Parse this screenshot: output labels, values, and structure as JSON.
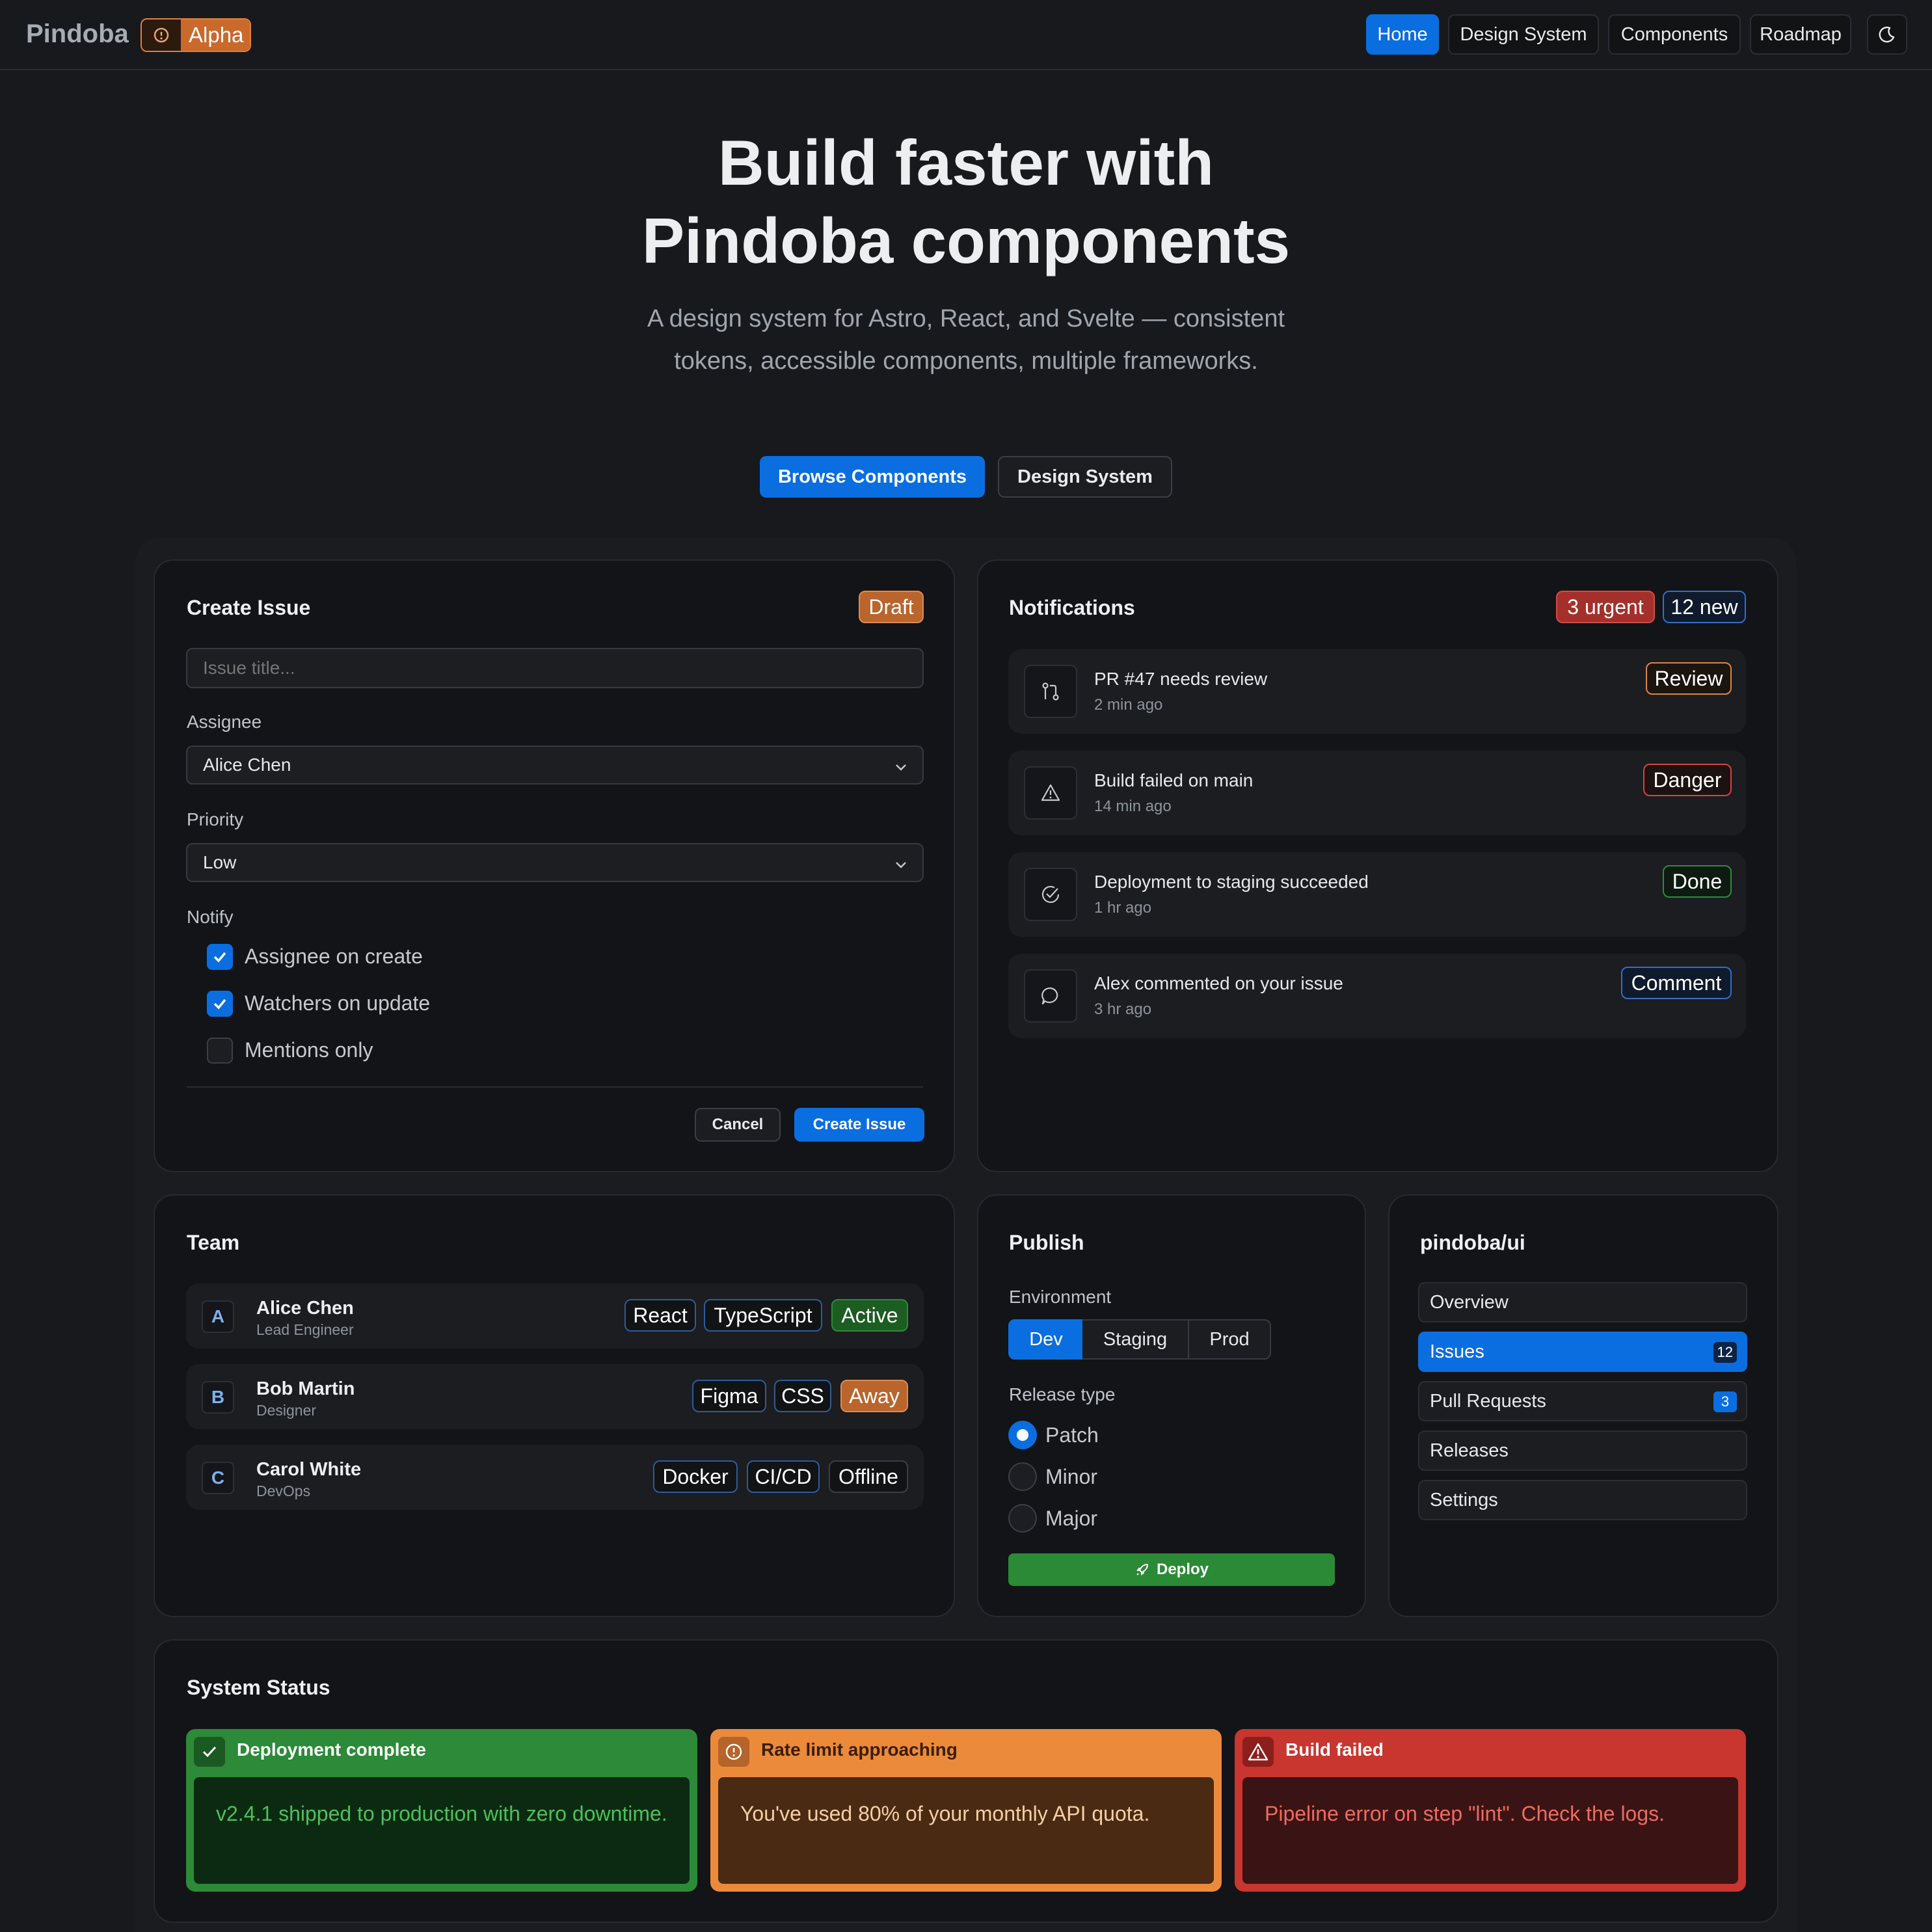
{
  "nav": {
    "brand": "Pindoba",
    "badge": "Alpha",
    "links": [
      "Home",
      "Design System",
      "Components",
      "Roadmap"
    ]
  },
  "hero": {
    "title_line1": "Build faster with",
    "title_line2": "Pindoba components",
    "subtitle": "A design system for Astro, React, and Svelte — consistent tokens, accessible components, multiple frameworks.",
    "primary_cta": "Browse Components",
    "secondary_cta": "Design System"
  },
  "create_issue": {
    "title": "Create Issue",
    "status": "Draft",
    "title_placeholder": "Issue title...",
    "assignee_label": "Assignee",
    "assignee_value": "Alice Chen",
    "priority_label": "Priority",
    "priority_value": "Low",
    "notify_label": "Notify",
    "options": [
      {
        "label": "Assignee on create",
        "checked": true
      },
      {
        "label": "Watchers on update",
        "checked": true
      },
      {
        "label": "Mentions only",
        "checked": false
      }
    ],
    "cancel": "Cancel",
    "submit": "Create Issue"
  },
  "notifications": {
    "title": "Notifications",
    "urgent": "3 urgent",
    "new": "12 new",
    "items": [
      {
        "icon": "pull-request-icon",
        "title": "PR #47 needs review",
        "time": "2 min ago",
        "tag": "Review"
      },
      {
        "icon": "warning-icon",
        "title": "Build failed on main",
        "time": "14 min ago",
        "tag": "Danger"
      },
      {
        "icon": "check-circle-icon",
        "title": "Deployment to staging succeeded",
        "time": "1 hr ago",
        "tag": "Done"
      },
      {
        "icon": "comment-icon",
        "title": "Alex commented on your issue",
        "time": "3 hr ago",
        "tag": "Comment"
      }
    ]
  },
  "team": {
    "title": "Team",
    "members": [
      {
        "initial": "A",
        "name": "Alice Chen",
        "role": "Lead Engineer",
        "tags": [
          "React",
          "TypeScript"
        ],
        "status": "Active"
      },
      {
        "initial": "B",
        "name": "Bob Martin",
        "role": "Designer",
        "tags": [
          "Figma",
          "CSS"
        ],
        "status": "Away"
      },
      {
        "initial": "C",
        "name": "Carol White",
        "role": "DevOps",
        "tags": [
          "Docker",
          "CI/CD"
        ],
        "status": "Offline"
      }
    ]
  },
  "publish": {
    "title": "Publish",
    "env_label": "Environment",
    "envs": [
      "Dev",
      "Staging",
      "Prod"
    ],
    "selected_env": "Dev",
    "release_label": "Release type",
    "releases": [
      "Patch",
      "Minor",
      "Major"
    ],
    "selected_release": "Patch",
    "deploy": "Deploy"
  },
  "repo": {
    "title": "pindoba/ui",
    "items": [
      {
        "label": "Overview",
        "count": ""
      },
      {
        "label": "Issues",
        "count": "12"
      },
      {
        "label": "Pull Requests",
        "count": "3"
      },
      {
        "label": "Releases",
        "count": ""
      },
      {
        "label": "Settings",
        "count": ""
      }
    ],
    "active": "Issues"
  },
  "status": {
    "title": "System Status",
    "alerts": [
      {
        "title": "Deployment complete",
        "body": "v2.4.1 shipped to production with zero downtime."
      },
      {
        "title": "Rate limit approaching",
        "body": "You've used 80% of your monthly API quota."
      },
      {
        "title": "Build failed",
        "body": "Pipeline error on step \"lint\". Check the logs."
      }
    ]
  },
  "colors": {
    "accent": "#0a6ee0",
    "success": "#2e8b3a",
    "warning": "#ec8a3c",
    "danger": "#d23b34"
  }
}
